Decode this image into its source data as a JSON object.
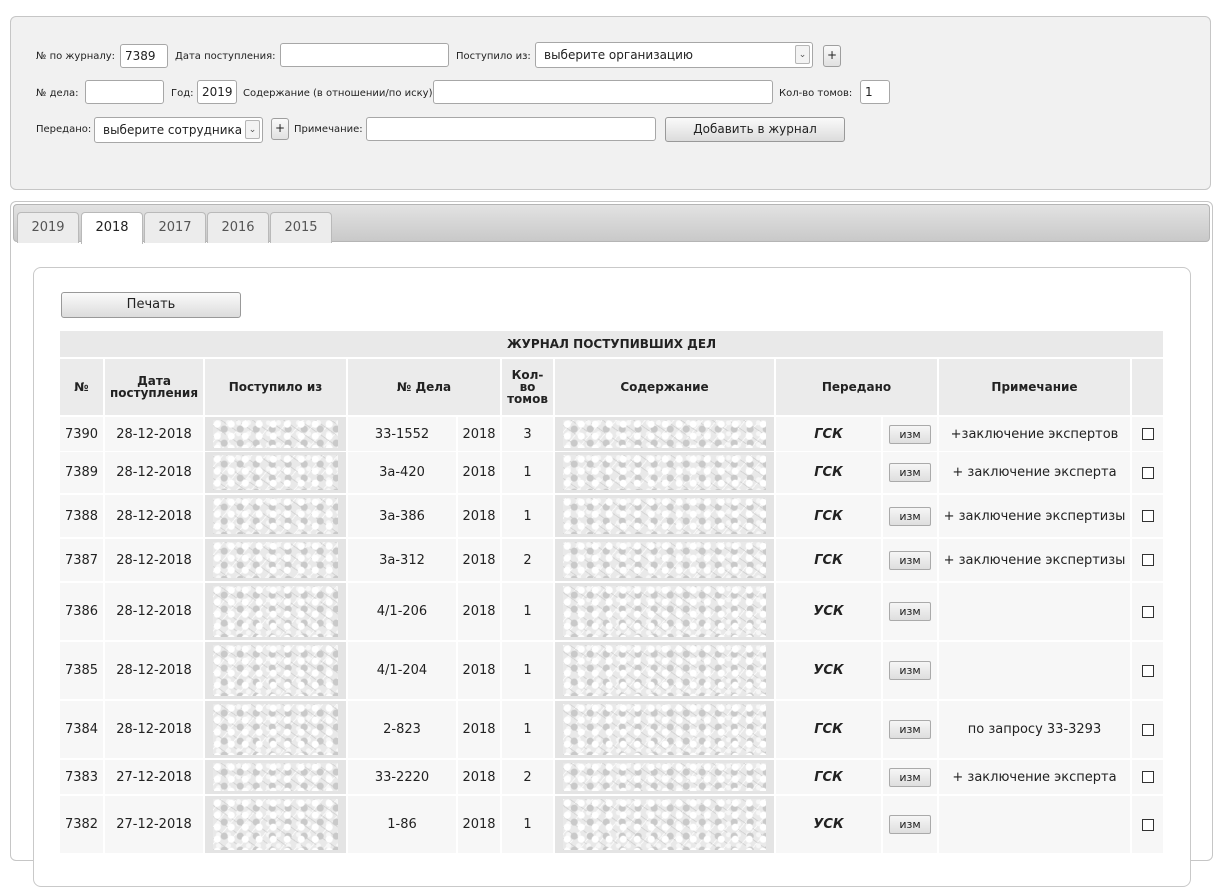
{
  "form": {
    "journal_no_label": "№ по журналу:",
    "journal_no_value": "7389",
    "date_label": "Дата поступления:",
    "date_value": "",
    "from_label": "Поступило из:",
    "from_selected": "выберите организацию",
    "case_no_label": "№ дела:",
    "case_no_value": "",
    "year_label": "Год:",
    "year_value": "2019",
    "content_label": "Содержание (в отношении/по иску):",
    "content_value": "",
    "volumes_label": "Кол-во томов:",
    "volumes_value": "1",
    "transferred_label": "Передано:",
    "transferred_selected": "выберите сотрудника",
    "note_label": "Примечание:",
    "note_value": "",
    "plus_label": "+",
    "add_button": "Добавить в журнал"
  },
  "tabs": [
    "2019",
    "2018",
    "2017",
    "2016",
    "2015"
  ],
  "active_tab": "2018",
  "print_button": "Печать",
  "table": {
    "title": "ЖУРНАЛ ПОСТУПИВШИХ ДЕЛ",
    "headers": {
      "no": "№",
      "date": "Дата поступления",
      "from": "Поступило из",
      "case": "№ Дела",
      "volumes": "Кол-во томов",
      "content": "Содержание",
      "transferred": "Передано",
      "note": "Примечание"
    },
    "edit_label": "изм",
    "rows": [
      {
        "no": "7390",
        "date": "28-12-2018",
        "case": "33-1552",
        "year": "2018",
        "volumes": "3",
        "transferred": "ГСК",
        "note": "+заключение экспертов"
      },
      {
        "no": "7389",
        "date": "28-12-2018",
        "case": "3а-420",
        "year": "2018",
        "volumes": "1",
        "transferred": "ГСК",
        "note": "+ заключение эксперта"
      },
      {
        "no": "7388",
        "date": "28-12-2018",
        "case": "3а-386",
        "year": "2018",
        "volumes": "1",
        "transferred": "ГСК",
        "note": "+ заключение экспертизы"
      },
      {
        "no": "7387",
        "date": "28-12-2018",
        "case": "3а-312",
        "year": "2018",
        "volumes": "2",
        "transferred": "ГСК",
        "note": "+ заключение экспертизы"
      },
      {
        "no": "7386",
        "date": "28-12-2018",
        "case": "4/1-206",
        "year": "2018",
        "volumes": "1",
        "transferred": "УСК",
        "note": ""
      },
      {
        "no": "7385",
        "date": "28-12-2018",
        "case": "4/1-204",
        "year": "2018",
        "volumes": "1",
        "transferred": "УСК",
        "note": ""
      },
      {
        "no": "7384",
        "date": "28-12-2018",
        "case": "2-823",
        "year": "2018",
        "volumes": "1",
        "transferred": "ГСК",
        "note": "по запросу 33-3293"
      },
      {
        "no": "7383",
        "date": "27-12-2018",
        "case": "33-2220",
        "year": "2018",
        "volumes": "2",
        "transferred": "ГСК",
        "note": "+ заключение эксперта"
      },
      {
        "no": "7382",
        "date": "27-12-2018",
        "case": "1-86",
        "year": "2018",
        "volumes": "1",
        "transferred": "УСК",
        "note": ""
      }
    ]
  }
}
